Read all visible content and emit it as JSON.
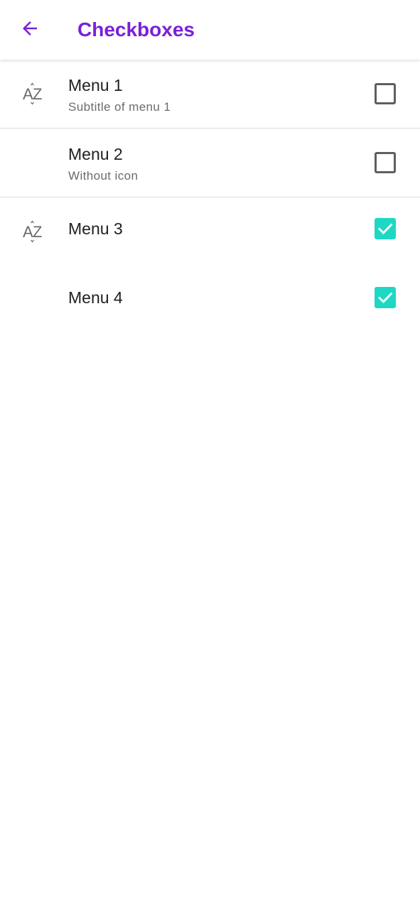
{
  "appbar": {
    "title": "Checkboxes",
    "back_icon": "arrow-left-icon"
  },
  "colors": {
    "accent": "#7B1FD8",
    "checkbox_checked": "#1ED8C4",
    "checkbox_unchecked_border": "#5F5F5F",
    "icon_gray": "#6B6B6B"
  },
  "menu": [
    {
      "title": "Menu 1",
      "subtitle": "Subtitle of menu 1",
      "icon": "sort-alphabetical-icon",
      "checked": false
    },
    {
      "title": "Menu 2",
      "subtitle": "Without icon",
      "icon": "",
      "checked": false
    },
    {
      "title": "Menu 3",
      "subtitle": "",
      "icon": "sort-alphabetical-icon",
      "checked": true
    },
    {
      "title": "Menu 4",
      "subtitle": "",
      "icon": "",
      "checked": true
    }
  ]
}
